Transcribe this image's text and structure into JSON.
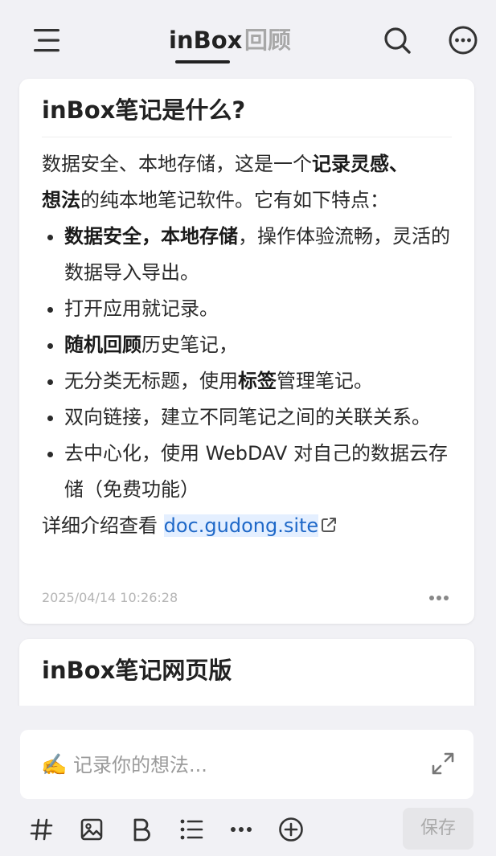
{
  "header": {
    "tabs": [
      {
        "label": "inBox",
        "active": true
      },
      {
        "label": "回顾",
        "active": false
      }
    ],
    "icons": [
      "menu-icon",
      "search-icon",
      "more-icon"
    ]
  },
  "notes": [
    {
      "title": "inBox笔记是什么?",
      "intro_prefix": "数据安全、本地存储，这是一个",
      "intro_bold1": "记录灵感、",
      "intro_bold2": "想法",
      "intro_suffix": "的纯本地笔记软件。它有如下特点：",
      "bullets": [
        {
          "bold": "数据安全，本地存储",
          "text": "，操作体验流畅，灵活的数据导入导出。"
        },
        {
          "text": "打开应用就记录。"
        },
        {
          "bold": "随机回顾",
          "text": "历史笔记，"
        },
        {
          "prefix": "无分类无标题，使用",
          "bold": "标签",
          "text": "管理笔记。"
        },
        {
          "text": "双向链接，建立不同笔记之间的关联关系。"
        },
        {
          "text": "去中心化，使用 WebDAV 对自己的数据云存储（免费功能）"
        }
      ],
      "detail_prefix": "详细介绍查看 ",
      "link_text": "doc.gudong.site",
      "timestamp": "2025/04/14 10:26:28"
    },
    {
      "title": "inBox笔记网页版"
    }
  ],
  "composer": {
    "pencil_emoji": "✍️",
    "placeholder": "记录你的想法...",
    "save_label": "保存",
    "tools": [
      "hashtag-icon",
      "image-icon",
      "bold-icon",
      "list-icon",
      "more-icon",
      "add-icon"
    ]
  },
  "colors": {
    "background": "#f1f1f5",
    "card": "#ffffff",
    "link": "#1e68c8",
    "link_highlight": "#e4efff",
    "inactive_tab": "#a8a8a8"
  }
}
